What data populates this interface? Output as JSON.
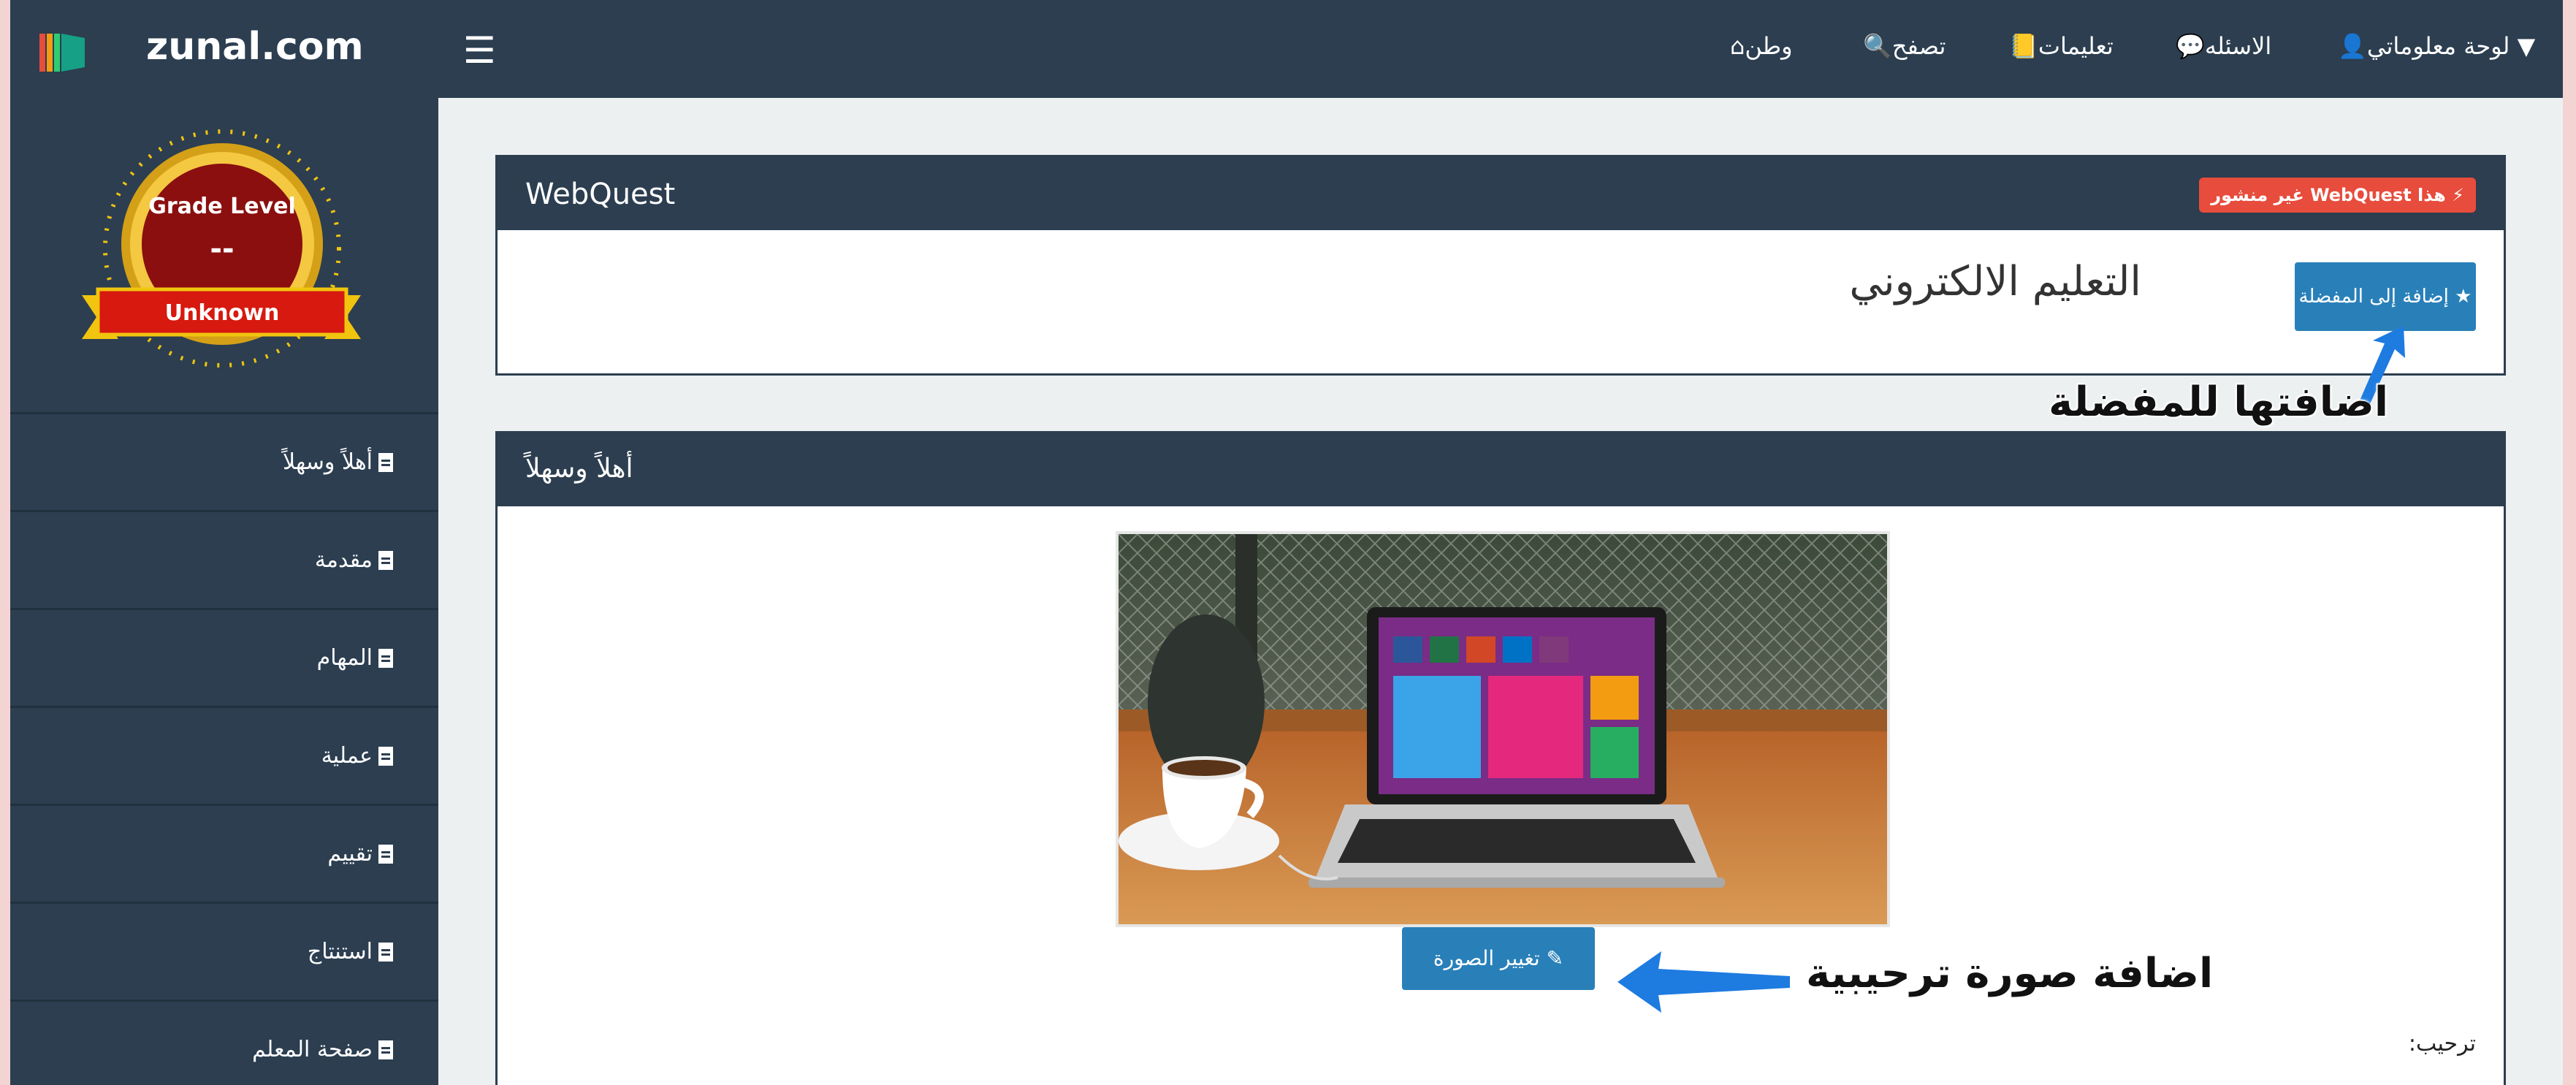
{
  "brand": {
    "name": "zunal.com"
  },
  "topnav": {
    "items": [
      {
        "label": "لوحة معلوماتي",
        "icon": "user-icon"
      },
      {
        "label": "الاسئله",
        "icon": "comments-icon"
      },
      {
        "label": "تعليمات",
        "icon": "book-icon"
      },
      {
        "label": "تصفح",
        "icon": "search-icon"
      },
      {
        "label": "وطن",
        "icon": "home-icon"
      }
    ]
  },
  "badge": {
    "title": "Grade Level",
    "value": "--",
    "ribbon": "Unknown"
  },
  "sidebar": {
    "items": [
      {
        "label": "أهلاً وسهلاً"
      },
      {
        "label": "مقدمة"
      },
      {
        "label": "المهام"
      },
      {
        "label": "عملية"
      },
      {
        "label": "تقييم"
      },
      {
        "label": "استنتاج"
      },
      {
        "label": "صفحة المعلم"
      }
    ]
  },
  "webquest_panel": {
    "header": "WebQuest",
    "status_badge": "هذا WebQuest غير منشور",
    "favorite_button": "إضافة إلى المفضلة",
    "title": "التعليم الالكتروني"
  },
  "welcome_panel": {
    "header": "أهلاً وسهلاً",
    "change_image_button": "تغيير الصورة",
    "label": "ترحيب:"
  },
  "annotations": {
    "favorite_note": "اضافتها للمفضلة",
    "image_note": "اضافة صورة ترحيبية"
  },
  "colors": {
    "navbar": "#2c3e50",
    "primary_button": "#2980b9",
    "danger_badge": "#e74c3c",
    "annotation_arrow": "#1e7be0"
  }
}
